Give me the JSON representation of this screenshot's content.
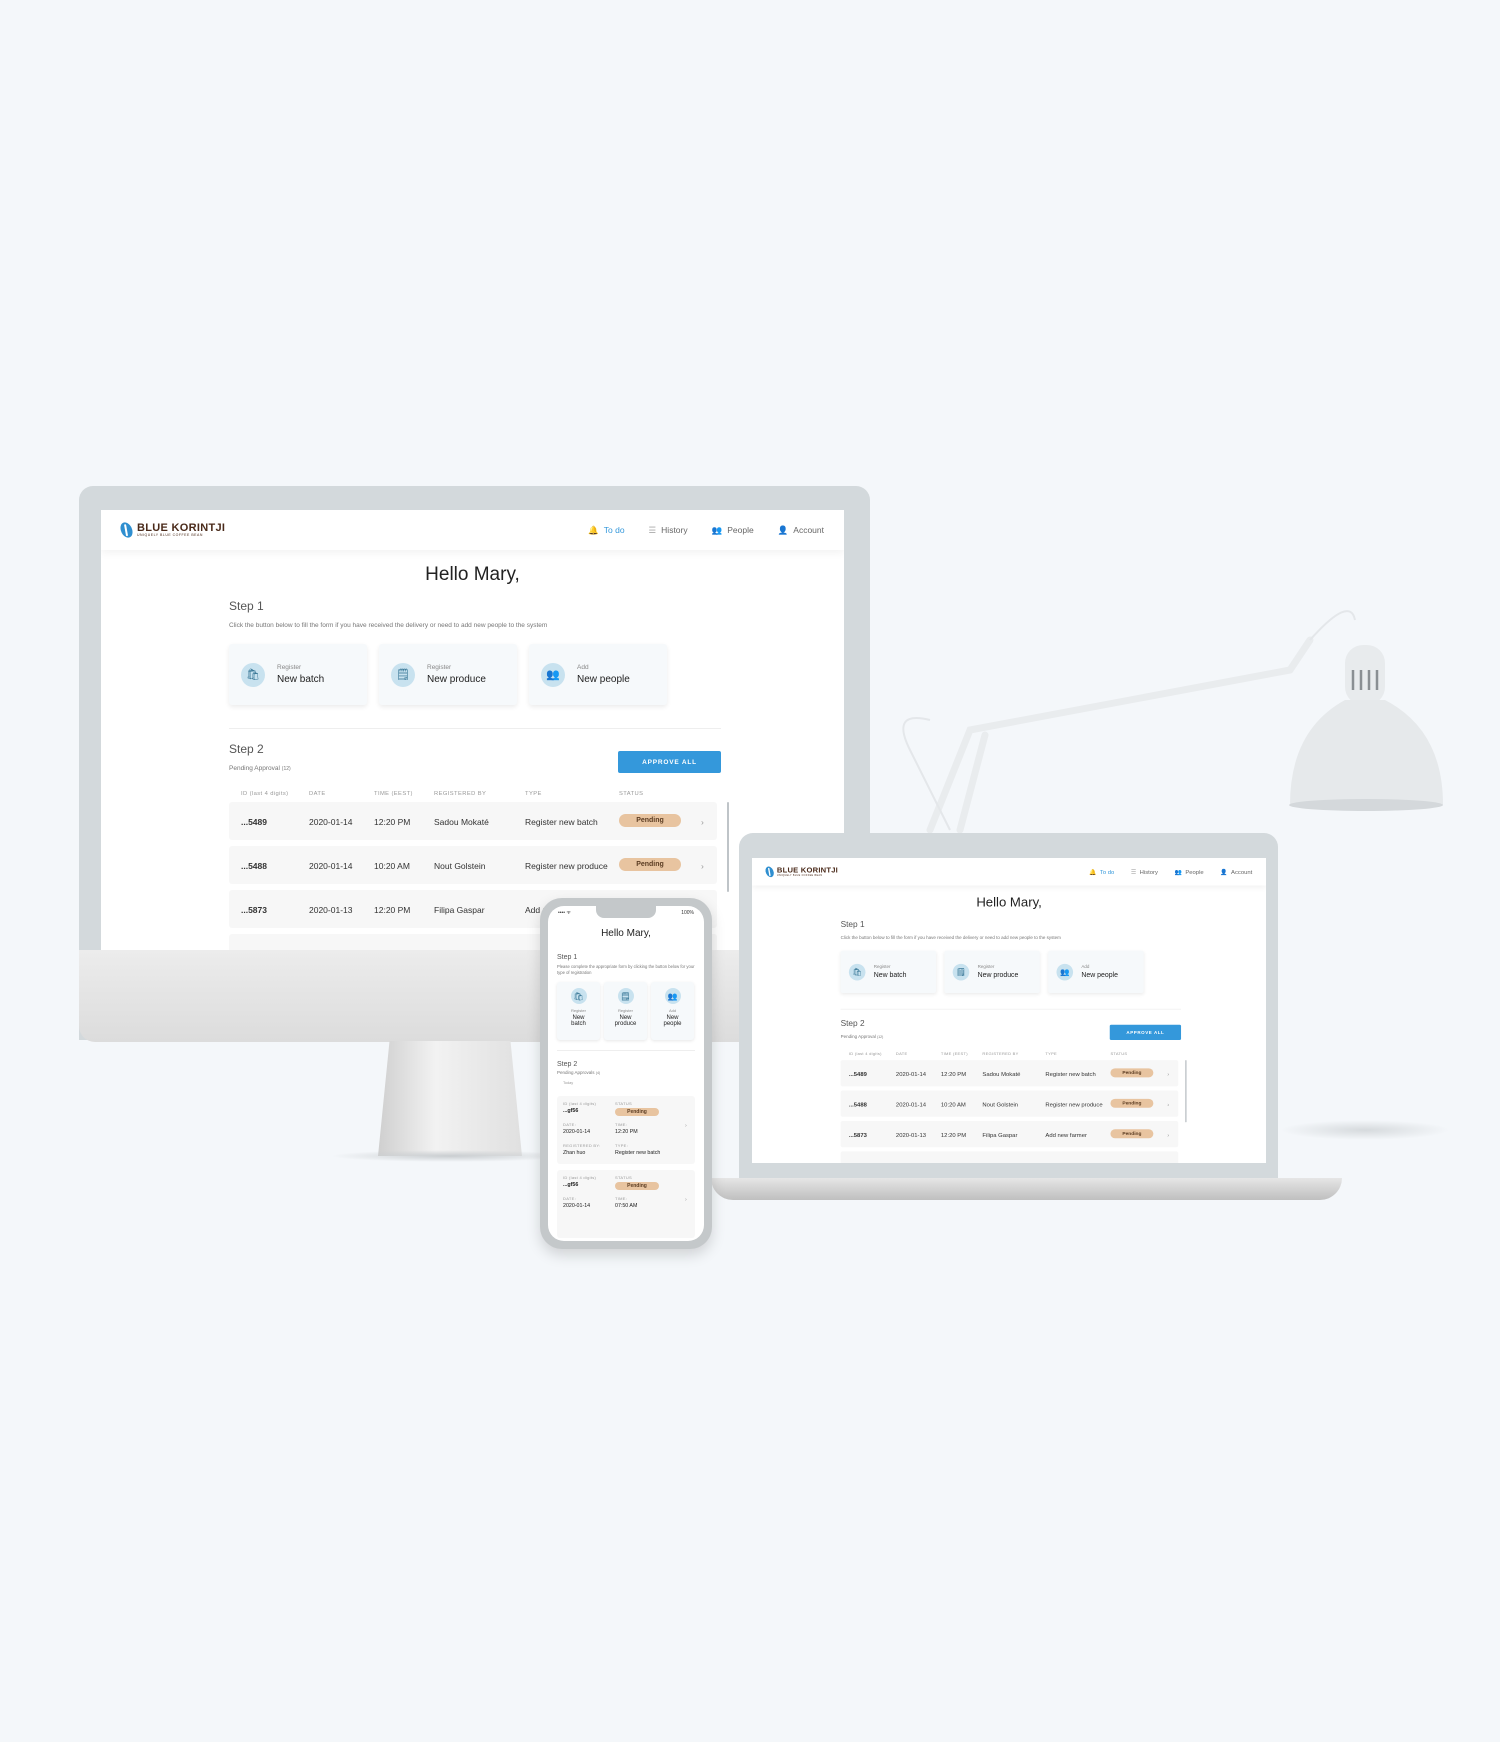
{
  "brand": {
    "name": "BLUE KORINTJI",
    "tagline": "UNIQUELY BLUE COFFEE BEAN"
  },
  "nav": [
    {
      "label": "To do",
      "icon": "bell-icon",
      "active": true
    },
    {
      "label": "History",
      "icon": "list-icon"
    },
    {
      "label": "People",
      "icon": "people-icon"
    },
    {
      "label": "Account",
      "icon": "user-icon"
    }
  ],
  "greeting": "Hello Mary,",
  "step1": {
    "title": "Step 1",
    "description": "Click the button below to fill the form if you have received the delivery or need to add new people to the system",
    "cards": [
      {
        "kicker": "Register",
        "label": "New batch",
        "icon": "bag-icon"
      },
      {
        "kicker": "Register",
        "label": "New produce",
        "icon": "produce-icon"
      },
      {
        "kicker": "Add",
        "label": "New people",
        "icon": "people-icon"
      }
    ]
  },
  "step2": {
    "title": "Step 2",
    "subtitle": "Pending Approval",
    "count": "(12)",
    "approve_label": "APPROVE ALL"
  },
  "table": {
    "columns": [
      "ID (last 4 digits)",
      "DATE",
      "TIME (EEST)",
      "REGISTERED BY",
      "TYPE",
      "STATUS"
    ],
    "rows": [
      {
        "id": "...5489",
        "date": "2020-01-14",
        "time": "12:20 PM",
        "by": "Sadou Mokaté",
        "type": "Register new batch",
        "status": "Pending"
      },
      {
        "id": "...5488",
        "date": "2020-01-14",
        "time": "10:20 AM",
        "by": "Nout Golstein",
        "type": "Register new produce",
        "status": "Pending"
      },
      {
        "id": "...5873",
        "date": "2020-01-13",
        "time": "12:20 PM",
        "by": "Filipa Gaspar",
        "type": "Add new farmer",
        "status": "Pending"
      }
    ]
  },
  "colors": {
    "accent": "#3498db",
    "pending": "#e8c4a0",
    "background": "#f4f7fa"
  },
  "phone": {
    "battery": "100%",
    "step1_description": "Please complete the appropriate form by clicking the button below for your type of registration",
    "cards": [
      {
        "kicker": "Register",
        "line1": "New",
        "line2": "batch"
      },
      {
        "kicker": "Register",
        "line1": "New",
        "line2": "produce"
      },
      {
        "kicker": "Add",
        "line1": "New",
        "line2": "people"
      }
    ],
    "step2_subtitle": "Pending Approvals",
    "step2_count": "(4)",
    "group": "Today",
    "field_labels": {
      "id": "ID (last 4 digits)",
      "status": "STATUS",
      "date": "DATE:",
      "time": "TIME:",
      "by": "REGISTERED BY:",
      "type": "TYPE:"
    },
    "items": [
      {
        "id": "...gf56",
        "status": "Pending",
        "date": "2020-01-14",
        "time": "12:20 PM",
        "by": "Zhan huo",
        "type": "Register new batch"
      },
      {
        "id": "...gf56",
        "status": "Pending",
        "date": "2020-01-14",
        "time": "07:50 AM"
      }
    ]
  }
}
